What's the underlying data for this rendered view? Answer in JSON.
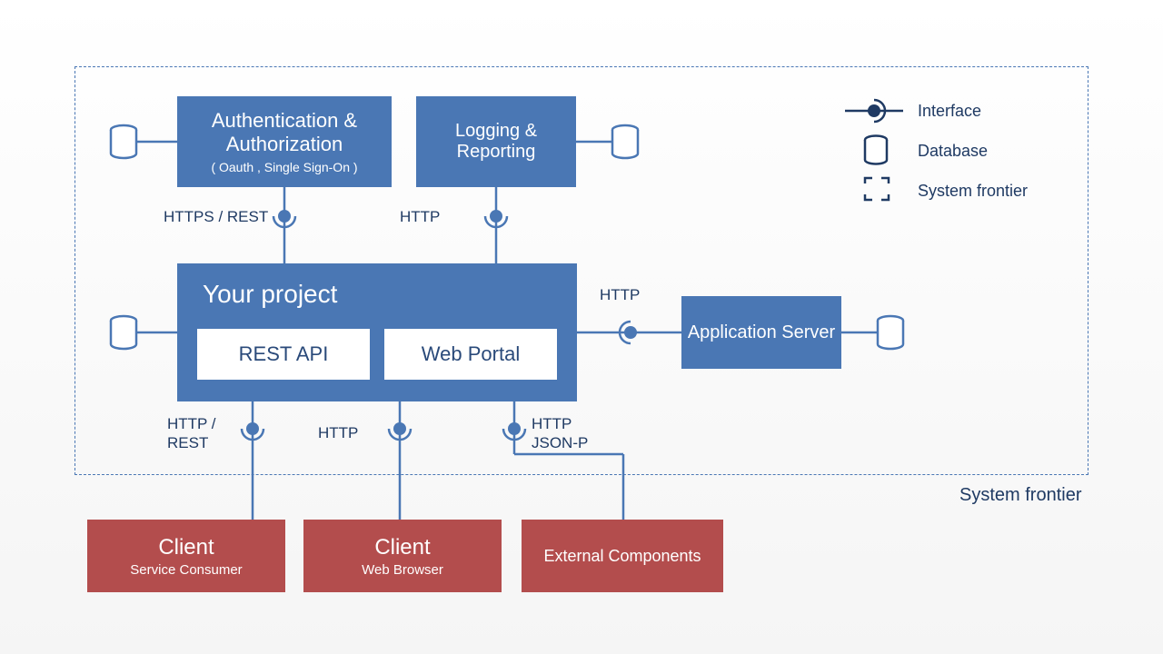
{
  "boxes": {
    "auth": {
      "title": "Authentication & Authorization",
      "sub": "( Oauth , Single Sign-On )"
    },
    "logging": {
      "title": "Logging & Reporting"
    },
    "project": {
      "title": "Your project",
      "rest": "REST  API",
      "portal": "Web Portal"
    },
    "appserver": {
      "title": "Application Server"
    },
    "client1": {
      "title": "Client",
      "sub": "Service Consumer"
    },
    "client2": {
      "title": "Client",
      "sub": "Web Browser"
    },
    "external": {
      "title": "External Components"
    }
  },
  "labels": {
    "auth_conn": "HTTPS / REST",
    "logging_conn": "HTTP",
    "appserver_conn": "HTTP",
    "client1_conn": "HTTP / REST",
    "client2_conn": "HTTP",
    "external_conn": "HTTP JSON-P"
  },
  "legend": {
    "interface": "Interface",
    "database": "Database",
    "frontier": "System frontier"
  },
  "frontier_caption": "System frontier"
}
